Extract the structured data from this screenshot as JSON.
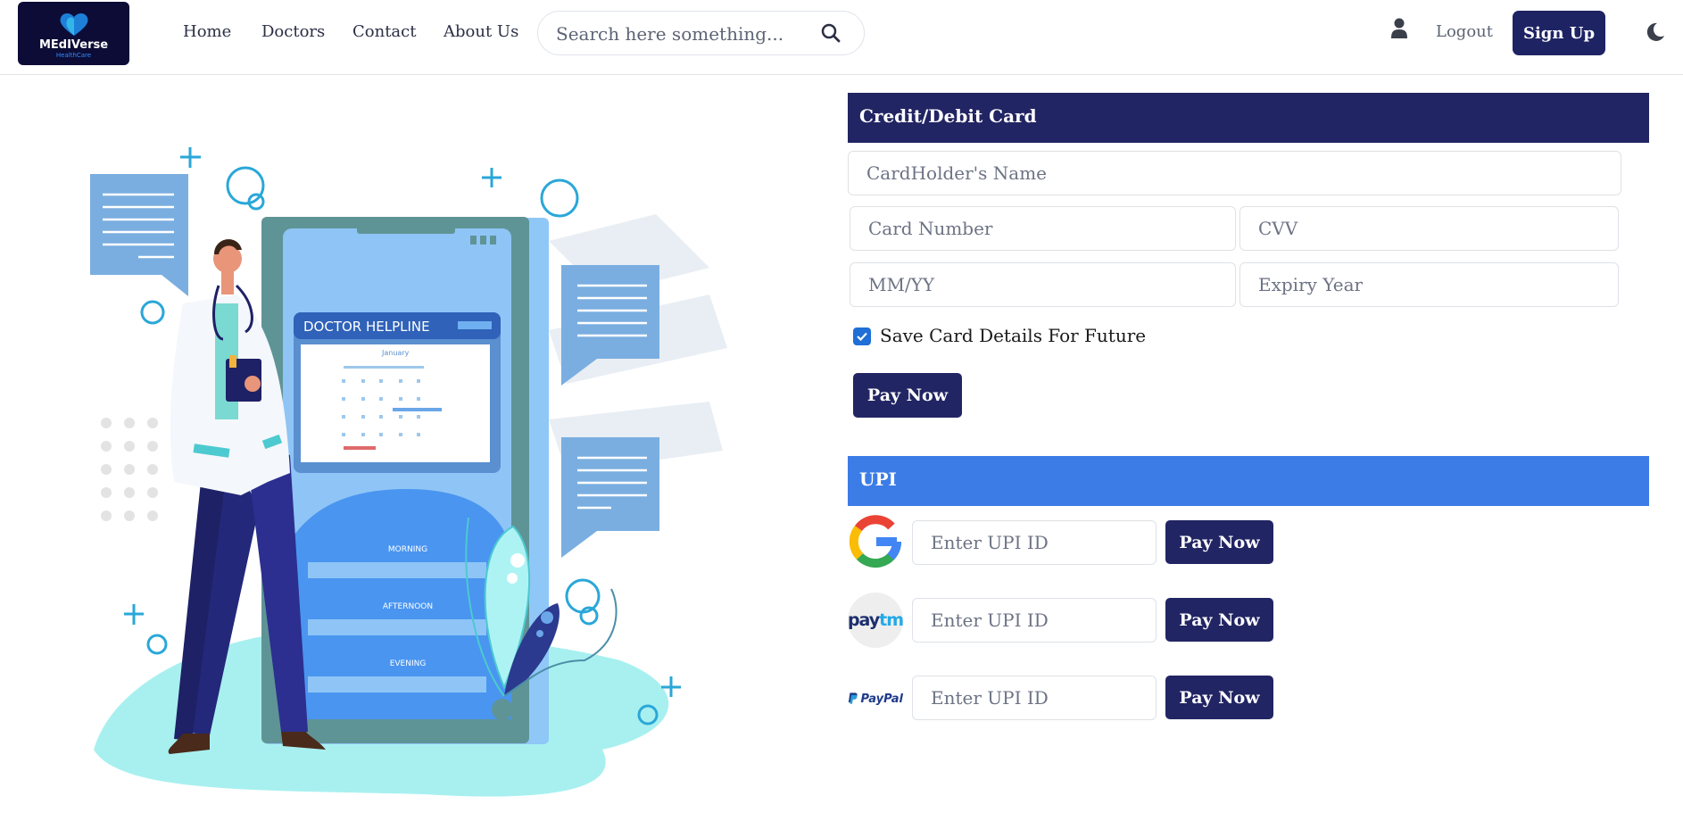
{
  "header": {
    "logo_title": "MEdIVerse",
    "logo_sub": "HealthCare",
    "nav": [
      "Home",
      "Doctors",
      "Contact",
      "About Us"
    ],
    "search_placeholder": "Search here something...",
    "logout_label": "Logout",
    "signup_label": "Sign Up",
    "icons": [
      "search-icon",
      "user-icon",
      "moon-icon"
    ]
  },
  "illustration": {
    "phone_header": "DOCTOR HELPLINE",
    "month": "January",
    "slots": [
      "MORNING",
      "AFTERNOON",
      "EVENING"
    ]
  },
  "card_section": {
    "title": "Credit/Debit Card",
    "cardholder_placeholder": "CardHolder's Name",
    "card_number_placeholder": "Card Number",
    "cvv_placeholder": "CVV",
    "mmyy_placeholder": "MM/YY",
    "expiry_year_placeholder": "Expiry Year",
    "save_label": "Save Card Details For Future",
    "save_checked": true,
    "pay_label": "Pay Now"
  },
  "upi_section": {
    "title": "UPI",
    "rows": [
      {
        "provider": "google-logo",
        "placeholder": "Enter UPI ID",
        "pay_label": "Pay Now"
      },
      {
        "provider": "paytm-logo",
        "logo_text_left": "pay",
        "logo_text_right": "tm",
        "placeholder": "Enter UPI ID",
        "pay_label": "Pay Now"
      },
      {
        "provider": "paypal-logo",
        "logo_text": "PayPal",
        "placeholder": "Enter UPI ID",
        "pay_label": "Pay Now"
      }
    ]
  },
  "colors": {
    "primary": "#222563",
    "upi_header": "#3c7ce6",
    "logo_bg": "#0c0c36",
    "illustration_blue": "#4a95f0",
    "illustration_teal": "#a8f0f0"
  }
}
